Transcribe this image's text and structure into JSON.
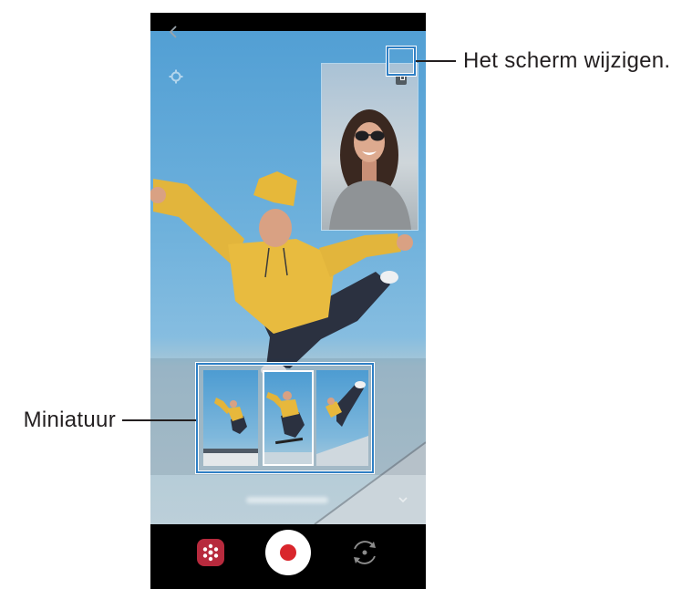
{
  "callouts": {
    "switch_screen": {
      "label": "Het scherm wijzigen."
    },
    "thumbnail": {
      "label": "Miniatuur"
    }
  },
  "camera": {
    "top_bar": {
      "back_icon": "chevron-left-icon"
    },
    "preview": {
      "settings_icon": "gear-icon",
      "pip": {
        "switch_screen_icon": "switch-screen-icon"
      },
      "thumbnails": [
        {
          "selected": false
        },
        {
          "selected": true
        },
        {
          "selected": false
        }
      ],
      "overlay_icon": "collapse-icon"
    },
    "controls": {
      "effects_icon": "effects-icon",
      "record_icon": "record-icon",
      "switch_camera_icon": "switch-camera-icon"
    }
  },
  "colors": {
    "callout_highlight": "#2f7fc4",
    "callout_line": "#231f20",
    "record": "#d9262c",
    "effects_button": "#b72a3d",
    "control_bar": "#000000",
    "sky": "#529fd4"
  }
}
